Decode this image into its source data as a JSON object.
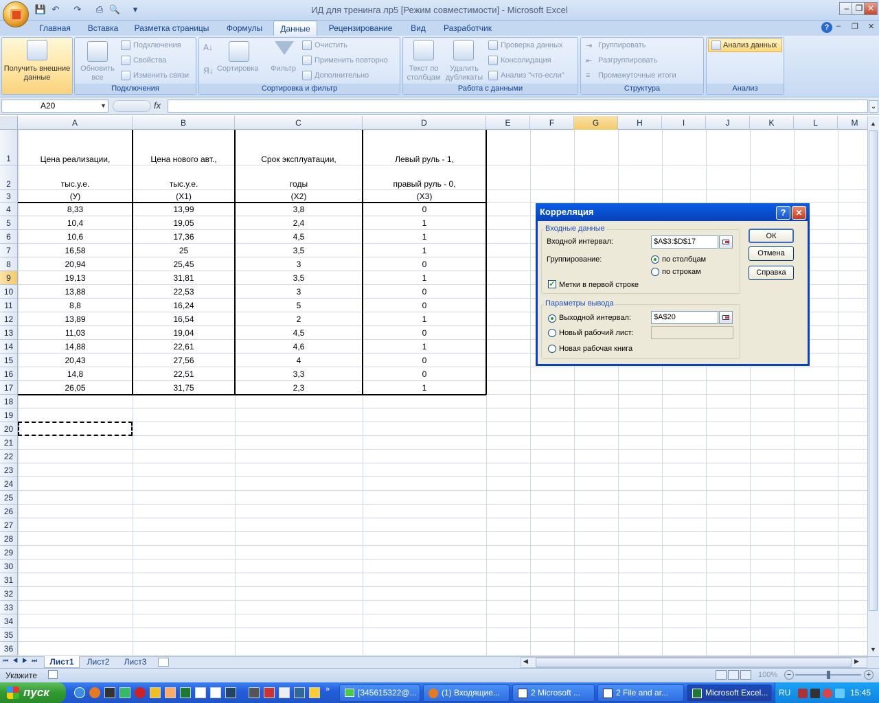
{
  "window": {
    "title": "ИД для тренинга лр5  [Режим совместимости] - Microsoft Excel"
  },
  "tabs": [
    "Главная",
    "Вставка",
    "Разметка страницы",
    "Формулы",
    "Данные",
    "Рецензирование",
    "Вид",
    "Разработчик"
  ],
  "ribbon": {
    "get_external": "Получить внешние данные",
    "refresh_all": "Обновить все",
    "connections": "Подключения",
    "properties": "Свойства",
    "edit_links": "Изменить связи",
    "group_connections": "Подключения",
    "sort": "Сортировка",
    "filter": "Фильтр",
    "clear": "Очистить",
    "reapply": "Применить повторно",
    "advanced": "Дополнительно",
    "group_sort": "Сортировка и фильтр",
    "text_to_columns": "Текст по столбцам",
    "remove_dup": "Удалить дубликаты",
    "validation": "Проверка данных",
    "consolidation": "Консолидация",
    "whatif": "Анализ \"что-если\"",
    "group_data": "Работа с данными",
    "group_btn": "Группировать",
    "ungroup_btn": "Разгруппировать",
    "subtotal": "Промежуточные итоги",
    "group_structure": "Структура",
    "analysis_btn": "Анализ данных",
    "group_analysis": "Анализ"
  },
  "formula_bar": {
    "name_box": "A20",
    "fx": "fx",
    "formula": ""
  },
  "columns": [
    "A",
    "B",
    "C",
    "D",
    "E",
    "F",
    "G",
    "H",
    "I",
    "J",
    "K",
    "L",
    "M"
  ],
  "headers": {
    "A": [
      "Цена реализации,",
      "тыс.у.е.",
      "(У)"
    ],
    "B": [
      "Цена нового авт.,",
      "тыс.у.е.",
      "(X1)"
    ],
    "C": [
      "Срок эксплуатации,",
      "годы",
      "(X2)"
    ],
    "D": [
      "Левый руль - 1,",
      "правый руль - 0,",
      "(X3)"
    ]
  },
  "rows": [
    [
      "8,33",
      "13,99",
      "3,8",
      "0"
    ],
    [
      "10,4",
      "19,05",
      "2,4",
      "1"
    ],
    [
      "10,6",
      "17,36",
      "4,5",
      "1"
    ],
    [
      "16,58",
      "25",
      "3,5",
      "1"
    ],
    [
      "20,94",
      "25,45",
      "3",
      "0"
    ],
    [
      "19,13",
      "31,81",
      "3,5",
      "1"
    ],
    [
      "13,88",
      "22,53",
      "3",
      "0"
    ],
    [
      "8,8",
      "16,24",
      "5",
      "0"
    ],
    [
      "13,89",
      "16,54",
      "2",
      "1"
    ],
    [
      "11,03",
      "19,04",
      "4,5",
      "0"
    ],
    [
      "14,88",
      "22,61",
      "4,6",
      "1"
    ],
    [
      "20,43",
      "27,56",
      "4",
      "0"
    ],
    [
      "14,8",
      "22,51",
      "3,3",
      "0"
    ],
    [
      "26,05",
      "31,75",
      "2,3",
      "1"
    ]
  ],
  "row_numbers": [
    "1",
    "2",
    "3",
    "4",
    "5",
    "6",
    "7",
    "8",
    "9",
    "10",
    "11",
    "12",
    "13",
    "14",
    "15",
    "16",
    "17",
    "18",
    "19",
    "20",
    "21",
    "22",
    "23",
    "24",
    "25",
    "26",
    "27",
    "28",
    "29",
    "30",
    "31",
    "32",
    "33",
    "34",
    "35",
    "36"
  ],
  "dialog": {
    "title": "Корреляция",
    "help": "?",
    "close": "✕",
    "input_section": "Входные данные",
    "input_range_label": "Входной интервал:",
    "input_range_value": "$A$3:$D$17",
    "grouping_label": "Группирование:",
    "by_columns": "по столбцам",
    "by_rows": "по строкам",
    "labels_first_row": "Метки в первой строке",
    "output_section": "Параметры вывода",
    "output_range_label": "Выходной интервал:",
    "output_range_value": "$A$20",
    "new_sheet": "Новый рабочий лист:",
    "new_sheet_value": "",
    "new_book": "Новая рабочая книга",
    "ok": "ОК",
    "cancel": "Отмена",
    "help_btn": "Справка"
  },
  "sheets": [
    "Лист1",
    "Лист2",
    "Лист3"
  ],
  "status": {
    "mode": "Укажите",
    "zoom": "100%"
  },
  "taskbar": {
    "start": "пуск",
    "items": [
      "[345615322@...",
      "(1) Входящие...",
      "2 Microsoft ...",
      "2 File and ar...",
      "Microsoft Excel..."
    ],
    "lang": "RU",
    "time": "15:45"
  }
}
